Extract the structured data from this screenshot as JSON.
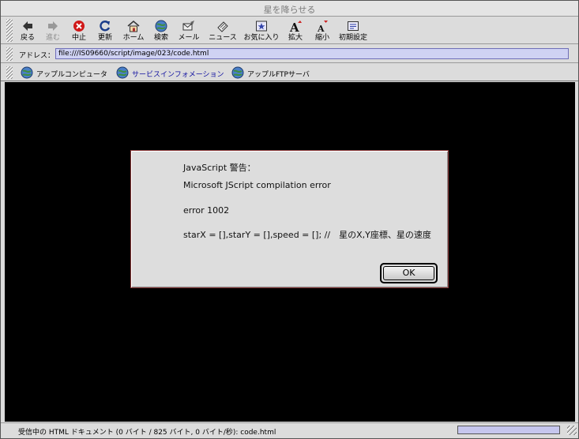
{
  "window": {
    "title": "星を降らせる"
  },
  "toolbar": {
    "buttons": [
      {
        "label": "戻る",
        "icon": "back-arrow-icon",
        "enabled": true
      },
      {
        "label": "進む",
        "icon": "forward-arrow-icon",
        "enabled": false
      },
      {
        "label": "中止",
        "icon": "stop-icon",
        "enabled": true
      },
      {
        "label": "更新",
        "icon": "refresh-icon",
        "enabled": true
      },
      {
        "label": "ホーム",
        "icon": "home-icon",
        "enabled": true
      },
      {
        "label": "検索",
        "icon": "search-globe-icon",
        "enabled": true
      },
      {
        "label": "メール",
        "icon": "mail-icon",
        "enabled": true
      },
      {
        "label": "ニュース",
        "icon": "news-icon",
        "enabled": true
      },
      {
        "label": "お気に入り",
        "icon": "favorites-icon",
        "enabled": true
      },
      {
        "label": "拡大",
        "icon": "text-larger-icon",
        "enabled": true
      },
      {
        "label": "縮小",
        "icon": "text-smaller-icon",
        "enabled": true
      },
      {
        "label": "初期設定",
        "icon": "preferences-icon",
        "enabled": true
      }
    ]
  },
  "address": {
    "label": "アドレス：",
    "value": "file:///IS09660/script/image/023/code.html"
  },
  "favorites": [
    {
      "label": "アップルコンピュータ",
      "icon": "globe-icon"
    },
    {
      "label": "サービスインフォメーション",
      "icon": "globe-icon"
    },
    {
      "label": "アップルFTPサーバ",
      "icon": "globe-icon"
    }
  ],
  "dialog": {
    "title": "JavaScript 警告：",
    "line1": "Microsoft JScript compilation error",
    "line2": "error 1002",
    "code": "starX = [],starY = [],speed = []; //　星のX,Y座標、星の速度",
    "ok_label": "OK"
  },
  "status": {
    "text": "受信中の HTML ドキュメント (0 バイト / 825 バイト, 0 バイト/秒): code.html",
    "progress": 1.0
  },
  "colors": {
    "accent": "#cfd2f3",
    "content_bg": "#000000",
    "dialog_border": "#8a3a3a"
  }
}
